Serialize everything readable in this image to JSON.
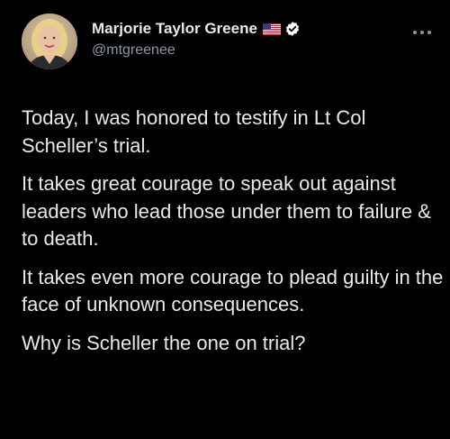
{
  "author": {
    "display_name": "Marjorie Taylor Greene",
    "handle": "@mtgreenee",
    "flag_icon": "us-flag-icon",
    "verified_icon": "verified-badge-icon",
    "avatar": "profile-photo"
  },
  "menu": {
    "icon": "more-options-icon"
  },
  "tweet": {
    "paragraphs": [
      "Today, I was honored to testify in Lt Col Scheller’s trial.",
      "It takes great courage to speak out against leaders who lead those under them to failure & to death.",
      "It takes even more courage to plead guilty in the face of unknown consequences.",
      "Why is Scheller the one on trial?"
    ]
  },
  "colors": {
    "background": "#000000",
    "text_primary": "#e7e9ea",
    "text_secondary": "#8b98a5",
    "verified_badge": "#ffffff"
  }
}
